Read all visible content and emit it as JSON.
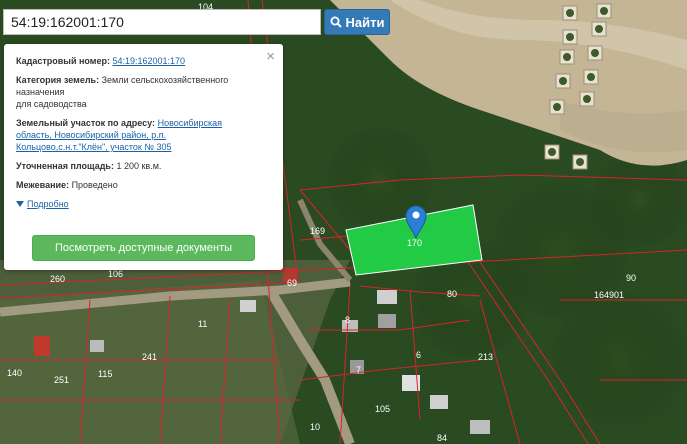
{
  "search": {
    "value": "54:19:162001:170",
    "button_label": "Найти"
  },
  "popup": {
    "cadastral_label": "Кадастровый номер:",
    "cadastral_value": "54:19:162001:170",
    "category_label": "Категория земель:",
    "category_value_1": "Земли сельскохозяйственного",
    "category_value_2": "назначения",
    "category_value_3": "для садоводства",
    "address_label": "Земельный участок по адресу:",
    "address_line_1": "Новосибирская",
    "address_line_2": "область, Новосибирский район, р.п.",
    "address_line_3": "Кольцово,с.н.т.\"Клён\", участок № 305",
    "area_label": "Уточненная площадь:",
    "area_value": "1 200 кв.м.",
    "survey_label": "Межевание:",
    "survey_value": "Проведено",
    "more_label": "Подробно",
    "docs_button": "Посмотреть доступные документы",
    "close_symbol": "×"
  },
  "map": {
    "parcel_labels": {
      "p170": "170",
      "p169": "169",
      "p69": "69",
      "p106": "106",
      "p260": "260",
      "p80": "80",
      "p90": "90",
      "block": "164901",
      "p11": "11",
      "p8": "8",
      "p241": "241",
      "p115": "115",
      "p140": "140",
      "p251": "251",
      "p6": "6",
      "p213": "213",
      "p7": "7",
      "p105": "105",
      "p10": "10",
      "p84": "84",
      "p104": "104"
    },
    "colors": {
      "parcel_fill": "#22d64a",
      "boundary": "#d8232a",
      "marker": "#2a7fd4"
    }
  }
}
